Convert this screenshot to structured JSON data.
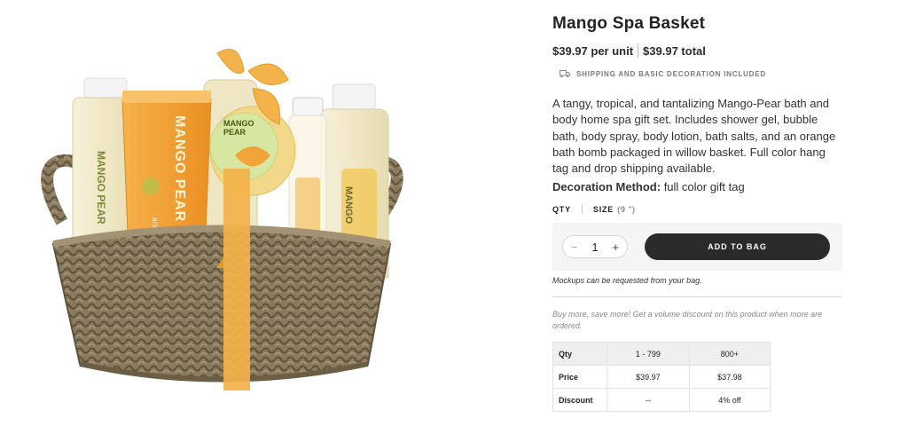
{
  "product": {
    "title": "Mango Spa Basket",
    "price_unit": "$39.97 per unit",
    "price_total": "$39.97 total",
    "shipping_note": "SHIPPING AND BASIC DECORATION INCLUDED",
    "description": "A tangy, tropical, and tantalizing Mango-Pear bath and body home spa gift set. Includes shower gel, bubble bath, body spray, body lotion, bath salts, and an orange bath bomb packaged in willow basket. Full color hang tag and drop shipping available.",
    "decoration_label": "Decoration Method:",
    "decoration_value": "full color gift tag"
  },
  "options": {
    "qty_label": "QTY",
    "size_label": "SIZE",
    "size_value": "(9 \")"
  },
  "cart": {
    "minus": "−",
    "quantity": "1",
    "plus": "+",
    "add_label": "ADD TO BAG"
  },
  "notes": {
    "mockups": "Mockups can be requested from your bag.",
    "volume": "Buy more, save more! Get a volume discount on this product when more are ordered."
  },
  "pricing_table": {
    "rows": [
      [
        "Qty",
        "1 - 799",
        "800+"
      ],
      [
        "Price",
        "$39.97",
        "$37.98"
      ],
      [
        "Discount",
        "--",
        "4% off"
      ]
    ]
  },
  "image_text": {
    "tube_label": "MANGO PEAR",
    "tube_small": "BODY LOTION",
    "tag_label_1": "MANGO",
    "tag_label_2": "PEAR",
    "bottle_left": "MANGO PEAR",
    "bottle_right": "MANGO"
  },
  "colors": {
    "accent_dark": "#2a2a2a",
    "ribbon": "#f4b24a",
    "mango": "#f0a43a"
  }
}
